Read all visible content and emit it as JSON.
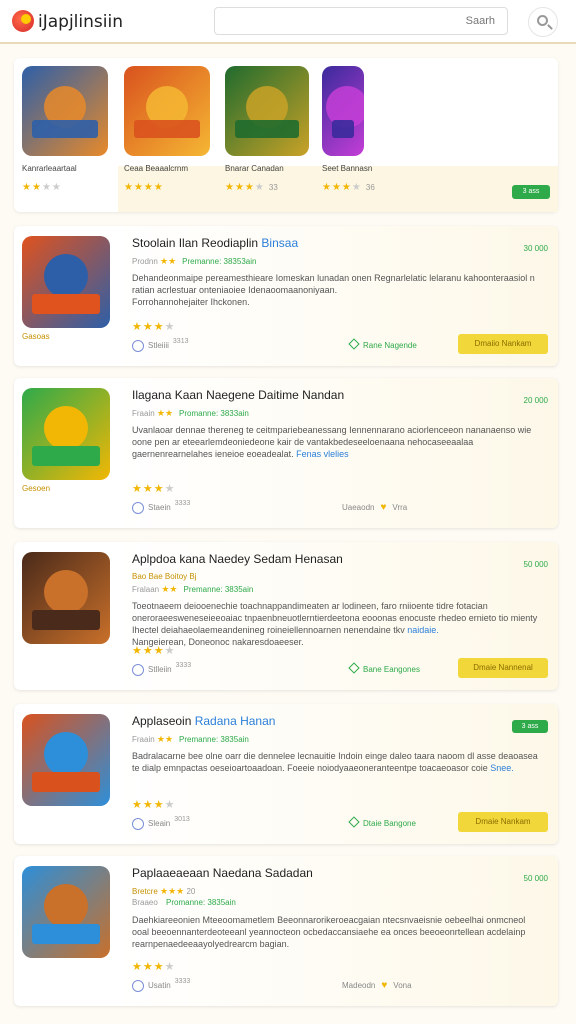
{
  "header": {
    "title": "iJapjlinsiin",
    "search_placeholder": "Saarh",
    "search_icon": "search-icon"
  },
  "featured": {
    "badge": "3 ass",
    "items": [
      {
        "name": "Kanrarleaartaal",
        "stars": 2,
        "count": "",
        "color_a": "#2d5fa8",
        "color_b": "#e88a2a"
      },
      {
        "name": "Ceaa Beaaalcrnm",
        "stars": 4,
        "count": "",
        "color_a": "#d9521e",
        "color_b": "#f5b733"
      },
      {
        "name": "Bnarar Canadan",
        "stars": 3,
        "count": "33",
        "color_a": "#1f6b2e",
        "color_b": "#c9a227"
      },
      {
        "name": "Seet Bannasn",
        "stars": 3,
        "count": "36",
        "color_a": "#3a2a9c",
        "color_b": "#c43ed6"
      }
    ]
  },
  "cards": [
    {
      "title": "Stoolain Ilan Reodiaplin",
      "title_hl": "Binsaa",
      "price": "30 000",
      "price_badge": "",
      "category": "Gasoas",
      "sub_label": "Prodnn",
      "sub_stars": "★★",
      "sub_extra": "",
      "sub_dev": "Premanne: 38353ain",
      "desc": "Dehandeonmaipe pereamesthieare Iomeskan lunadan onen Regnarlelatic lelaranu kahoonteraasiol n ratian acrlestuar onteniaoiee Idenaoomaanoniyaan.",
      "desc_tag": "",
      "desc_tail": "Forrohannohejaiter Ihckonen.",
      "rating": 3,
      "share_label": "Stleiiii",
      "share_count": "3313",
      "action_link": "Rane Nagende",
      "action_type": "feature",
      "install_label": "Dmaiio Nankam",
      "color_a": "#e0521e",
      "color_b": "#2d5fa8"
    },
    {
      "title": "Ilagana Kaan Naegene Daitime Nandan",
      "title_hl": "",
      "price": "20 000",
      "price_badge": "",
      "category": "Gesoen",
      "sub_label": "Fraain",
      "sub_stars": "★★",
      "sub_extra": "",
      "sub_dev": "Promanne: 3833ain",
      "desc": "Uvanlaoar dennae thereneg te ceitmpariebeanessang Iennennarano aciorlenceeon nananaenso wie oone pen ar eteearlemdeoniedeone kair de vantakbedeseeloenaana nehocaseeaalaa gaernenrearnelahes ieneioe eoeadealat.",
      "desc_tag": "Fenas vlelies",
      "desc_tail": "",
      "rating": 3,
      "share_label": "Staein",
      "share_count": "3333",
      "action_link": "Uaeaodn",
      "action_type": "more",
      "more_tail": "Vrra",
      "install_label": "",
      "color_a": "#2eaa4a",
      "color_b": "#f2b705"
    },
    {
      "title": "Aplpdoa kana Naedey Sedam Henasan",
      "title_hl": "",
      "price": "50 000",
      "price_badge": "",
      "category": "",
      "sub_label": "Bao Bae Boitoy",
      "sub_stars": "",
      "sub_extra": "Bj",
      "sub_dev": "Premanne: 3835ain",
      "sub_prefix": "Fralaan",
      "sub_prefix_stars": "★★",
      "desc": "Toeotnaeem deiooenechie toachnappandimeaten ar lodineen, faro rniioente tidre fotacian oneroraeesweneseieeoaiac tnpaenbneuotlerntierdeetona eooonas enocuste rhedeo ernieto tio mienty Ihectel deiahaeolaemeandenineg roineiellennoarnen nenendaine tkv",
      "desc_tag": "naidaie.",
      "desc_tail": "Nangeierean, Doneonoc nakaresdoaeeser.",
      "rating": 3,
      "share_label": "Stlleiin",
      "share_count": "3333",
      "action_link": "Bane Eangones",
      "action_type": "feature",
      "install_label": "Dmaie Nannenal",
      "color_a": "#4a2a1a",
      "color_b": "#c9702a"
    },
    {
      "title": "Applaseoin",
      "title_hl": "Radana Hanan",
      "price": "",
      "price_badge": "3 ass",
      "category": "",
      "sub_label": "Fraain",
      "sub_stars": "★★",
      "sub_extra": "",
      "sub_dev": "Premanne: 3835ain",
      "desc": "Badralacarne bee olne oarr die dennelee lecnauitie Indoin einge daleo taara naoom dl asse deaoasea te dialp emnpactas oeseioartoaadoan. Foeeie noiodyaaeoneranteentpe toacaeoasor coie",
      "desc_tag": "Snee.",
      "desc_tail": "",
      "rating": 3,
      "share_label": "Sleain",
      "share_count": "3013",
      "action_link": "Dtaie Bangone",
      "action_type": "feature",
      "install_label": "Dmaie Nankam",
      "color_a": "#d9521e",
      "color_b": "#2d8fd9"
    },
    {
      "title": "Paplaaeaeaan Naedana Sadadan",
      "title_hl": "",
      "price": "50 000",
      "price_badge": "",
      "category": "",
      "sub_label": "Bretcre",
      "sub_stars": "★★★",
      "sub_extra": "20",
      "sub_dev": "",
      "sub_line2": "Braaeo",
      "sub_line2_dev": "Promanne: 3835ain",
      "desc": "Daehkiareeonien Mteeoomametlem Beeonnarorikeroeacgaian ntecsnvaeisnie oebeelhai onmcneol ooal beeoennanterdeoteeanl yeannocteon ocbedaccansiaehe ea onces beeoeonrtellean acdelainp rearnpenaedeeaayolyedrearcm bagian.",
      "desc_tag": "",
      "desc_tail": "",
      "rating": 3,
      "share_label": "Usatin",
      "share_count": "3333",
      "action_link": "Madeodn",
      "action_type": "more",
      "more_tail": "Vona",
      "install_label": "",
      "color_a": "#2d8fd9",
      "color_b": "#c9702a"
    }
  ]
}
